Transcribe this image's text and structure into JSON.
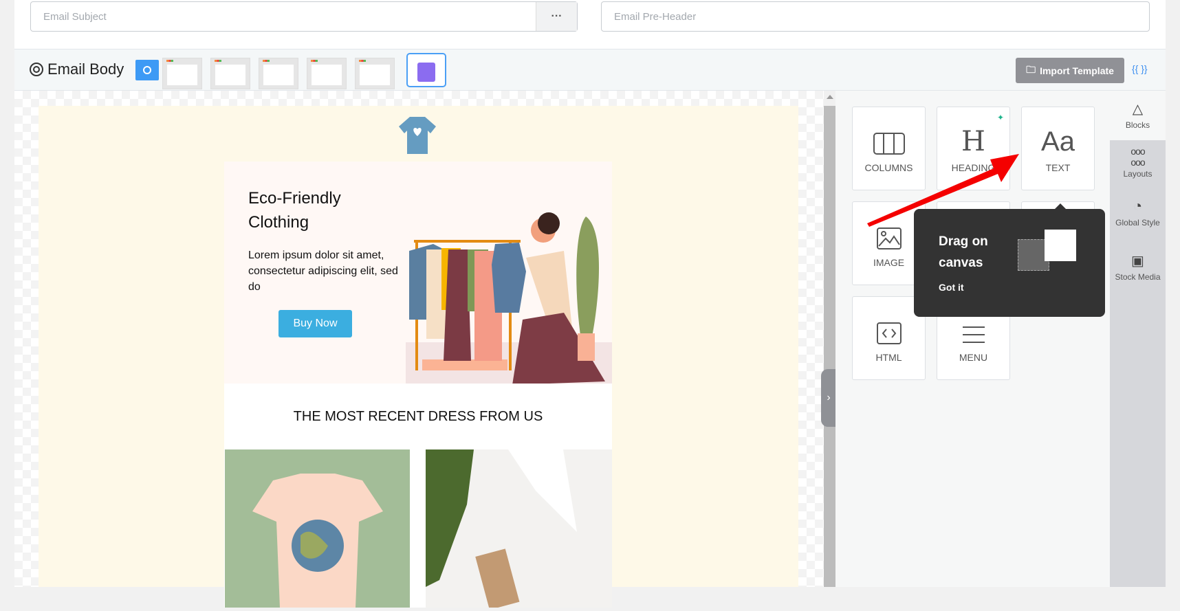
{
  "header": {
    "subject_placeholder": "Email Subject",
    "more_label": "···",
    "preheader_placeholder": "Email Pre-Header"
  },
  "body_bar": {
    "title": "Email Body",
    "import_label": "Import Template",
    "merge_tags_label": "{{ }}"
  },
  "email": {
    "hero_title_line1": "Eco-Friendly",
    "hero_title_line2": "Clothing",
    "hero_text": "Lorem ipsum dolor sit amet, consectetur adipiscing elit, sed do",
    "cta": "Buy Now",
    "section_title": "THE MOST RECENT DRESS FROM US",
    "cta_color": "#3baee0",
    "bg_color": "#fef9e8"
  },
  "blocks": [
    {
      "label": "COLUMNS",
      "icon": "columns-icon"
    },
    {
      "label": "HEADING",
      "icon": "heading-icon"
    },
    {
      "label": "TEXT",
      "icon": "text-icon"
    },
    {
      "label": "IMAGE",
      "icon": "image-icon"
    },
    {
      "label": "HTML",
      "icon": "code-icon"
    },
    {
      "label": "MENU",
      "icon": "menu-icon"
    }
  ],
  "tooltip": {
    "title_line1": "Drag on",
    "title_line2": "canvas",
    "dismiss": "Got it"
  },
  "side_tabs": [
    {
      "label": "Blocks"
    },
    {
      "label": "Layouts"
    },
    {
      "label": "Global Style"
    },
    {
      "label": "Stock Media"
    }
  ]
}
